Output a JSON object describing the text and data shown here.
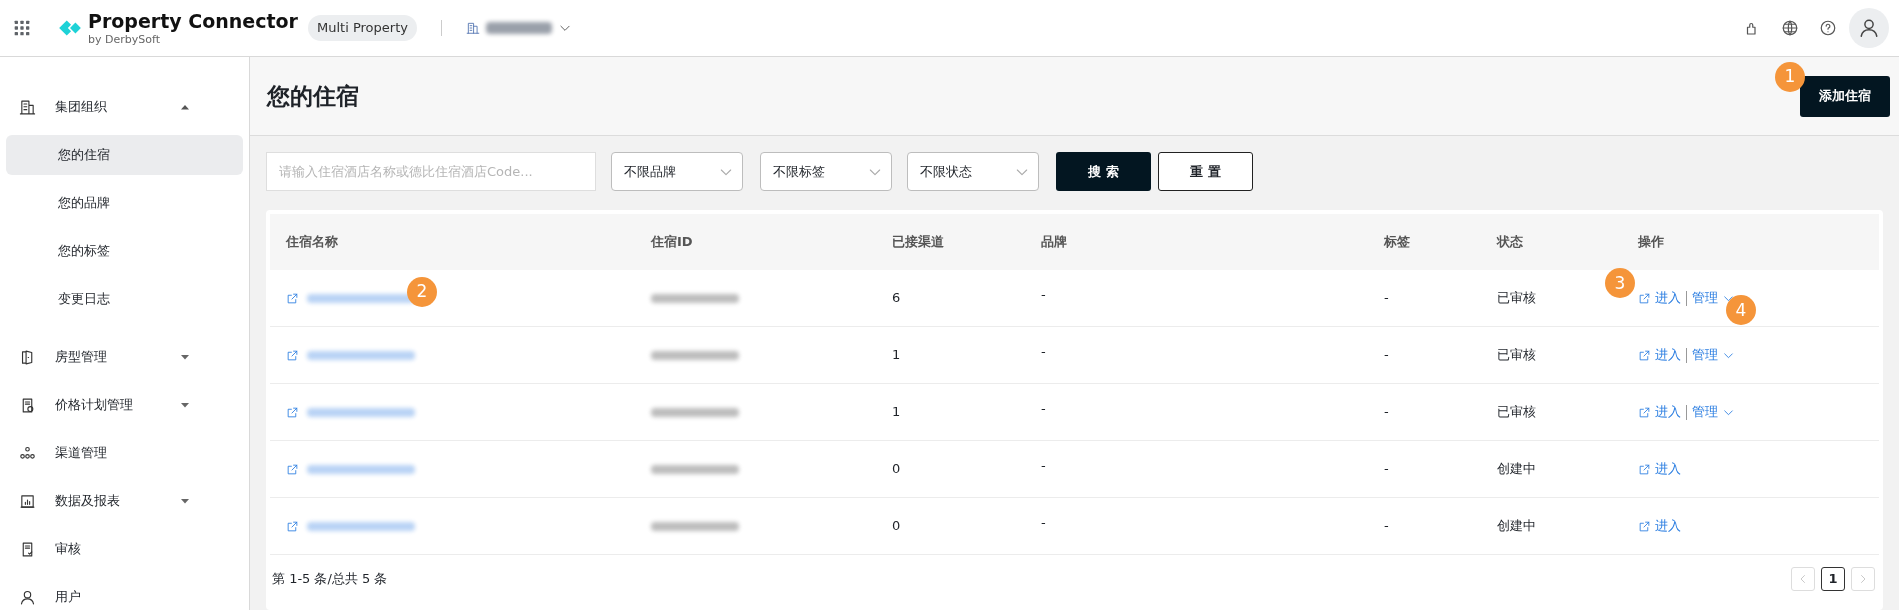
{
  "app": {
    "title": "Property Connector",
    "subtitle": "by DerbySoft",
    "badge": "Multi Property"
  },
  "sidebar": {
    "items": [
      {
        "label": "集团组织",
        "expanded": true,
        "children": [
          {
            "label": "您的住宿",
            "selected": true
          },
          {
            "label": "您的品牌",
            "selected": false
          },
          {
            "label": "您的标签",
            "selected": false
          },
          {
            "label": "变更日志",
            "selected": false
          }
        ]
      },
      {
        "label": "房型管理",
        "expanded": false
      },
      {
        "label": "价格计划管理",
        "expanded": false
      },
      {
        "label": "渠道管理"
      },
      {
        "label": "数据及报表",
        "expanded": false
      },
      {
        "label": "审核"
      },
      {
        "label": "用户"
      }
    ]
  },
  "page": {
    "title": "您的住宿",
    "add_button": "添加住宿"
  },
  "filters": {
    "search_placeholder": "请输入住宿酒店名称或德比住宿酒店Code...",
    "selects": [
      "不限品牌",
      "不限标签",
      "不限状态"
    ],
    "search_button": "搜 索",
    "reset_button": "重 置"
  },
  "table": {
    "columns": [
      "住宿名称",
      "住宿ID",
      "已接渠道",
      "品牌",
      "标签",
      "状态",
      "操作"
    ],
    "rows": [
      {
        "channels": "6",
        "brand": "-",
        "tag": "-",
        "status": "已审核",
        "enter": "进入",
        "manage": "管理"
      },
      {
        "channels": "1",
        "brand": "-",
        "tag": "-",
        "status": "已审核",
        "enter": "进入",
        "manage": "管理"
      },
      {
        "channels": "1",
        "brand": "-",
        "tag": "-",
        "status": "已审核",
        "enter": "进入",
        "manage": "管理"
      },
      {
        "channels": "0",
        "brand": "-",
        "tag": "-",
        "status": "创建中",
        "enter": "进入"
      },
      {
        "channels": "0",
        "brand": "-",
        "tag": "-",
        "status": "创建中",
        "enter": "进入"
      }
    ]
  },
  "pagination": {
    "summary": "第 1-5 条/总共 5 条",
    "pages": [
      {
        "label": "1",
        "selected": true
      }
    ]
  },
  "callouts": [
    "1",
    "2",
    "3",
    "4"
  ]
}
